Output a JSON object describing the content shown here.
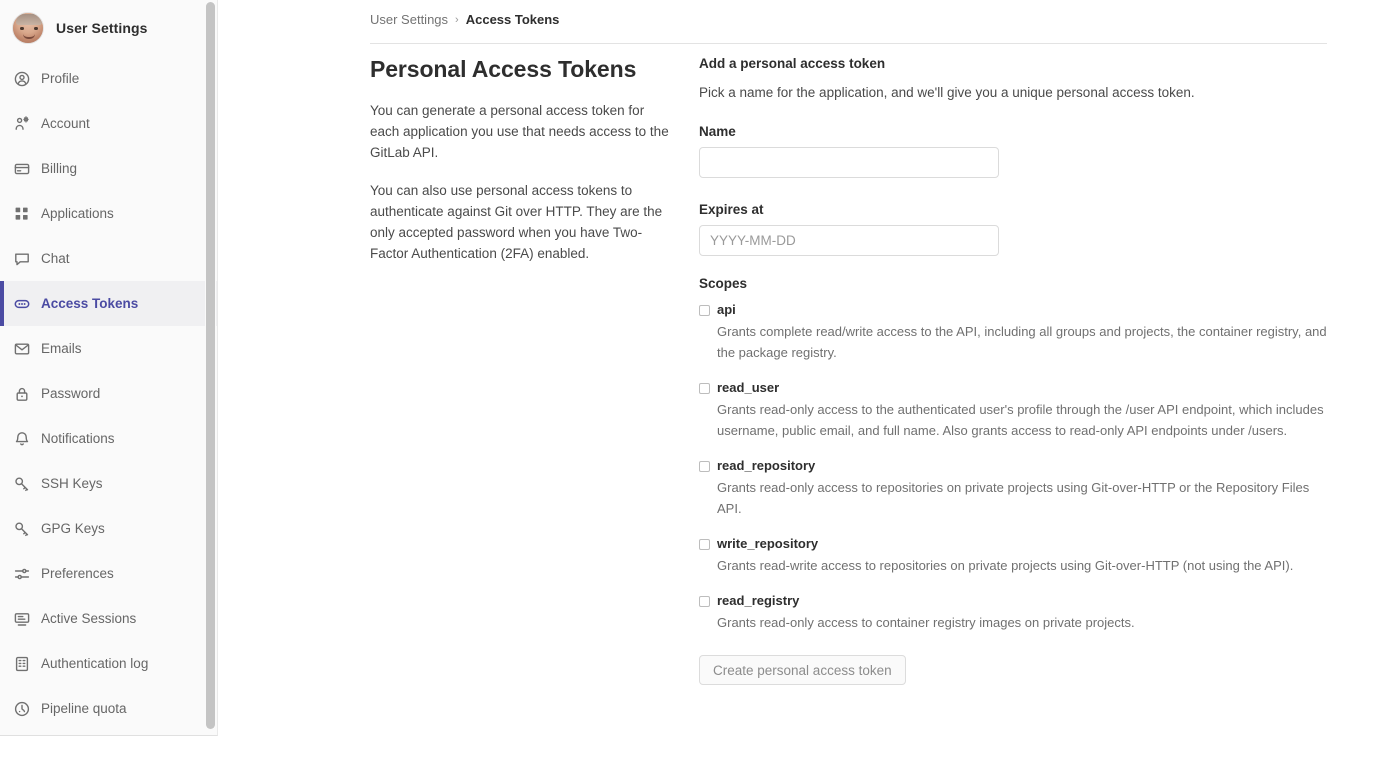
{
  "sidebar": {
    "title": "User Settings",
    "avatar_alt": "user-avatar",
    "items": [
      {
        "label": "Profile",
        "icon": "profile-icon",
        "active": false
      },
      {
        "label": "Account",
        "icon": "account-icon",
        "active": false
      },
      {
        "label": "Billing",
        "icon": "billing-icon",
        "active": false
      },
      {
        "label": "Applications",
        "icon": "applications-icon",
        "active": false
      },
      {
        "label": "Chat",
        "icon": "chat-icon",
        "active": false
      },
      {
        "label": "Access Tokens",
        "icon": "access-tokens-icon",
        "active": true
      },
      {
        "label": "Emails",
        "icon": "emails-icon",
        "active": false
      },
      {
        "label": "Password",
        "icon": "password-icon",
        "active": false
      },
      {
        "label": "Notifications",
        "icon": "notifications-icon",
        "active": false
      },
      {
        "label": "SSH Keys",
        "icon": "ssh-keys-icon",
        "active": false
      },
      {
        "label": "GPG Keys",
        "icon": "gpg-keys-icon",
        "active": false
      },
      {
        "label": "Preferences",
        "icon": "preferences-icon",
        "active": false
      },
      {
        "label": "Active Sessions",
        "icon": "active-sessions-icon",
        "active": false
      },
      {
        "label": "Authentication log",
        "icon": "authentication-log-icon",
        "active": false
      },
      {
        "label": "Pipeline quota",
        "icon": "pipeline-quota-icon",
        "active": false
      }
    ],
    "active_color": "#4b4ba3"
  },
  "breadcrumb": {
    "parent": "User Settings",
    "separator": "›",
    "current": "Access Tokens"
  },
  "left": {
    "title": "Personal Access Tokens",
    "paragraph_1": "You can generate a personal access token for each application you use that needs access to the GitLab API.",
    "paragraph_2": "You can also use personal access tokens to authenticate against Git over HTTP. They are the only accepted password when you have Two-Factor Authentication (2FA) enabled."
  },
  "form": {
    "heading": "Add a personal access token",
    "subheading": "Pick a name for the application, and we'll give you a unique personal access token.",
    "name_label": "Name",
    "name_value": "",
    "name_placeholder": "",
    "expires_label": "Expires at",
    "expires_value": "",
    "expires_placeholder": "YYYY-MM-DD",
    "scopes_label": "Scopes",
    "scopes": [
      {
        "name": "api",
        "checked": false,
        "description": "Grants complete read/write access to the API, including all groups and projects, the container registry, and the package registry."
      },
      {
        "name": "read_user",
        "checked": false,
        "description": "Grants read-only access to the authenticated user's profile through the /user API endpoint, which includes username, public email, and full name. Also grants access to read-only API endpoints under /users."
      },
      {
        "name": "read_repository",
        "checked": false,
        "description": "Grants read-only access to repositories on private projects using Git-over-HTTP or the Repository Files API."
      },
      {
        "name": "write_repository",
        "checked": false,
        "description": "Grants read-write access to repositories on private projects using Git-over-HTTP (not using the API)."
      },
      {
        "name": "read_registry",
        "checked": false,
        "description": "Grants read-only access to container registry images on private projects."
      }
    ],
    "submit_label": "Create personal access token"
  }
}
